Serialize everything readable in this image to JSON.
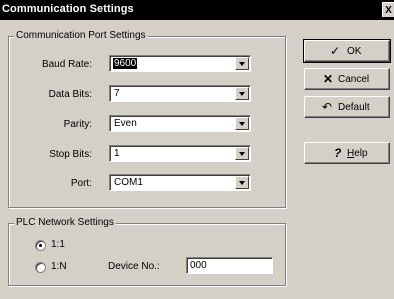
{
  "window": {
    "title": "Communication Settings",
    "close_glyph": "X"
  },
  "port_group": {
    "legend": "Communication Port Settings",
    "fields": [
      {
        "label": "Baud Rate:",
        "value": "9600"
      },
      {
        "label": "Data Bits:",
        "value": "7"
      },
      {
        "label": "Parity:",
        "value": "Even"
      },
      {
        "label": "Stop Bits:",
        "value": "1"
      },
      {
        "label": "Port:",
        "value": "COM1"
      }
    ]
  },
  "network_group": {
    "legend": "PLC Network Settings",
    "radio_1": {
      "label": "1:1",
      "checked": true
    },
    "radio_n": {
      "label": "1:N",
      "checked": false
    },
    "device_label": "Device No.:",
    "device_value": "000"
  },
  "buttons": {
    "ok": {
      "label": "OK",
      "icon": "check-icon"
    },
    "cancel": {
      "label": "Cancel",
      "icon": "x-icon"
    },
    "default": {
      "label": "Default",
      "icon": "undo-icon"
    },
    "help": {
      "label_prefix": "",
      "label_underlined": "H",
      "label_rest": "elp",
      "icon": "question-icon"
    }
  }
}
